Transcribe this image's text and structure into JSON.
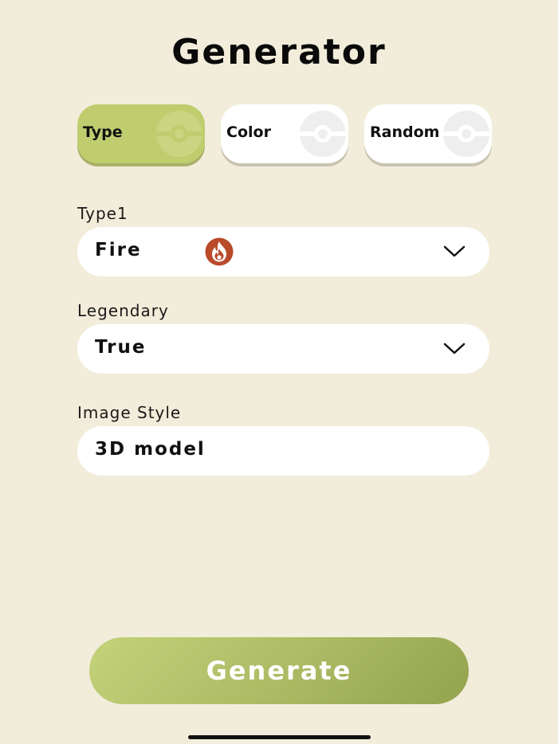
{
  "header": {
    "title": "Generator"
  },
  "mode_tabs": {
    "active": "Type",
    "items": [
      {
        "label": "Type",
        "icon": "pokeball-icon"
      },
      {
        "label": "Color",
        "icon": "pokeball-icon"
      },
      {
        "label": "Random",
        "icon": "pokeball-icon"
      }
    ]
  },
  "form": {
    "type1": {
      "label": "Type1",
      "value": "Fire",
      "icon": "fire-type-icon"
    },
    "legendary": {
      "label": "Legendary",
      "value": "True"
    },
    "image_style": {
      "label": "Image Style",
      "value": "3D model"
    }
  },
  "actions": {
    "generate_label": "Generate"
  },
  "colors": {
    "background": "#f2edda",
    "accent": "#bfcd6f",
    "fire": "#b94a2a"
  }
}
